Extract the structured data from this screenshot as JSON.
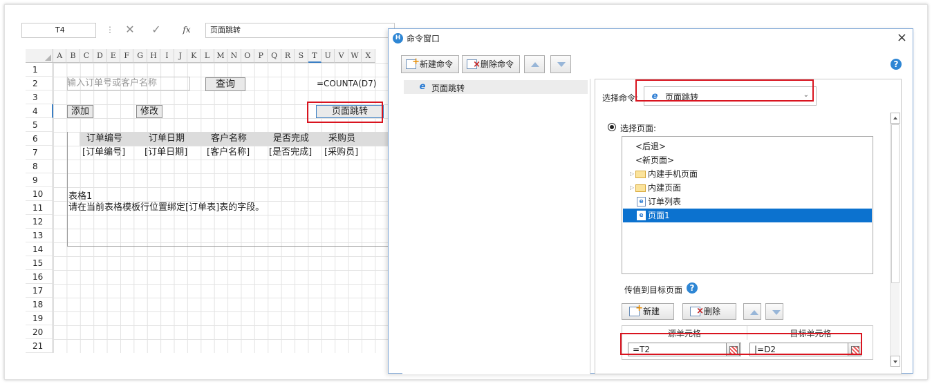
{
  "sheet": {
    "name_box": "T4",
    "formula_bar": "页面跳转",
    "columns": [
      "A",
      "B",
      "C",
      "D",
      "E",
      "F",
      "G",
      "H",
      "I",
      "J",
      "K",
      "L",
      "M",
      "N",
      "O",
      "P",
      "Q",
      "R",
      "S",
      "T",
      "U",
      "V",
      "W",
      "X"
    ],
    "rows": [
      "1",
      "2",
      "3",
      "4",
      "5",
      "6",
      "7",
      "8",
      "9",
      "10",
      "11",
      "12",
      "13",
      "14",
      "15",
      "16",
      "17",
      "18",
      "19",
      "20",
      "21"
    ],
    "search_placeholder": "输入订单号或客户名称",
    "query_button": "查询",
    "count_formula": "=COUNTA(D7)",
    "add_button": "添加",
    "edit_button": "修改",
    "jump_button": "页面跳转",
    "table_headers": [
      "订单编号",
      "订单日期",
      "客户名称",
      "是否完成",
      "采购员"
    ],
    "table_fields": [
      "[订单编号]",
      "[订单日期]",
      "[客户名称]",
      "[是否完成]",
      "[采购员]"
    ],
    "table_name": "表格1",
    "table_hint": "请在当前表格模板行位置绑定[订单表]表的字段。"
  },
  "dialog": {
    "title": "命令窗口",
    "close_glyph": "×",
    "new_command": "新建命令",
    "delete_command": "删除命令",
    "help_glyph": "?",
    "command_list": [
      "页面跳转"
    ],
    "select_command_label": "选择命令:",
    "select_command_value": "页面跳转",
    "select_page_label": "选择页面:",
    "tree": [
      {
        "label": "<后退>",
        "kind": "plain"
      },
      {
        "label": "<新页面>",
        "kind": "plain"
      },
      {
        "label": "内建手机页面",
        "kind": "folder"
      },
      {
        "label": "内建页面",
        "kind": "folder"
      },
      {
        "label": "订单列表",
        "kind": "page"
      },
      {
        "label": "页面1",
        "kind": "page",
        "selected": true
      }
    ],
    "pass_value_label": "传值到目标页面",
    "new_button": "新建",
    "delete_button": "删除",
    "source_header": "源单元格",
    "target_header": "目标单元格",
    "source_value": "=T2",
    "target_value": "|=D2"
  },
  "colors": {
    "accent": "#0c72cf",
    "highlight": "#d9141f",
    "help": "#2e86d4"
  }
}
